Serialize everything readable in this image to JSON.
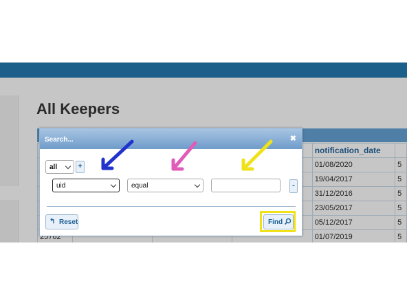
{
  "page": {
    "title": "All Keepers"
  },
  "grid": {
    "header": [
      "",
      "",
      "",
      "",
      "notification_date",
      ""
    ],
    "rows": [
      [
        "",
        "",
        "",
        "",
        "01/08/2020",
        "5"
      ],
      [
        "",
        "",
        "",
        "",
        "19/04/2017",
        "5"
      ],
      [
        "",
        "",
        "",
        "",
        "31/12/2016",
        "5"
      ],
      [
        "",
        "",
        "",
        "",
        "23/05/2017",
        "5"
      ],
      [
        "",
        "",
        "",
        "",
        "05/12/2017",
        "5"
      ],
      [
        "25762",
        "",
        "",
        "",
        "01/07/2019",
        "5"
      ]
    ]
  },
  "search_dialog": {
    "title": "Search...",
    "close_glyph": "✖",
    "group_op": "all",
    "add_rule_label": "+",
    "field": "uid",
    "operator": "equal",
    "value": "",
    "remove_rule_label": "-",
    "reset_label": "Reset",
    "find_label": "Find"
  },
  "annotations": {
    "arrow_colors": {
      "field": "#2233cc",
      "operator": "#e05cb8",
      "value": "#f0e21a"
    },
    "highlight_color": "#f1e118"
  },
  "icons": {
    "reset": "undo-icon",
    "find": "magnifier-icon",
    "close": "close-icon"
  }
}
